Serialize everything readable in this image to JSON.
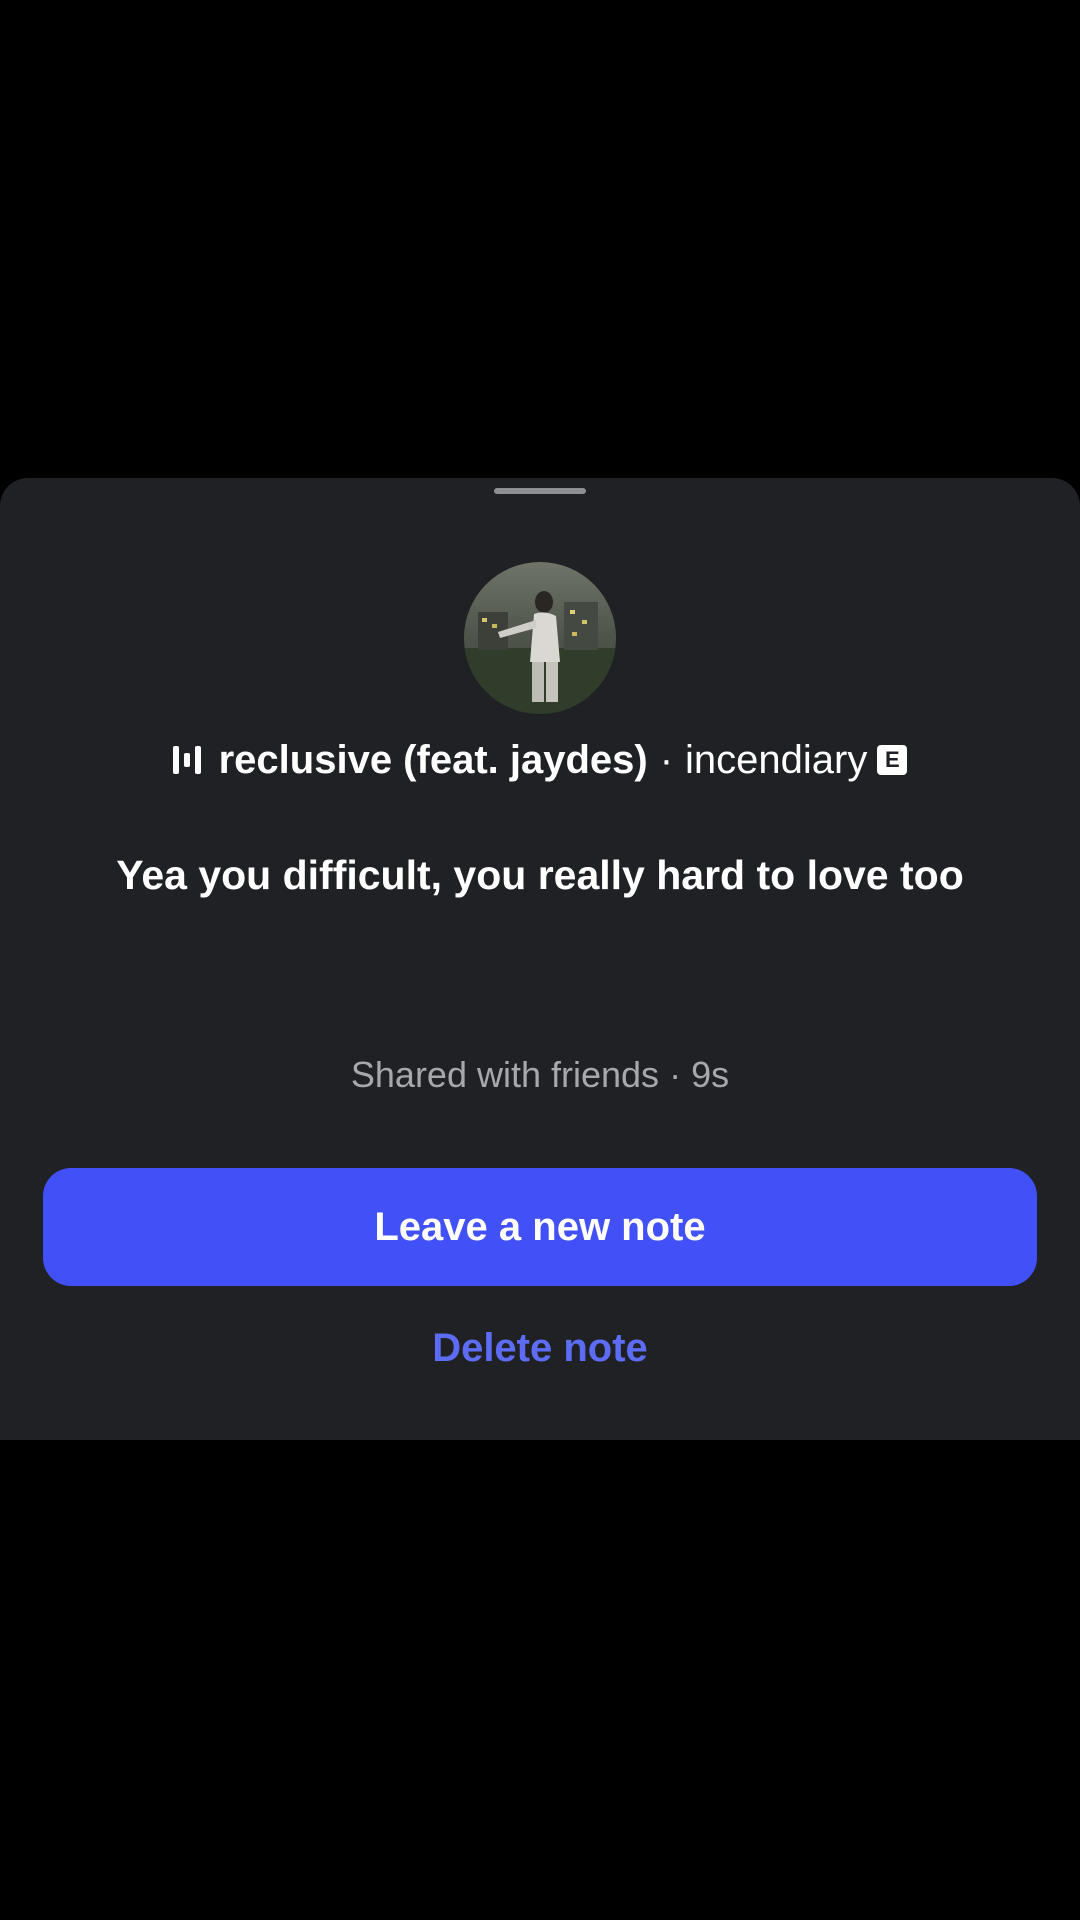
{
  "note_sheet": {
    "music": {
      "icon": "music-equalizer-icon",
      "song_title": "reclusive (feat. jaydes)",
      "separator": "·",
      "artist": "incendiary",
      "explicit_badge": "E"
    },
    "note_text": "Yea you difficult, you really hard to love too",
    "audience": "Shared with friends",
    "meta_separator": "·",
    "time_ago": "9s",
    "primary_action_label": "Leave a new note",
    "secondary_action_label": "Delete note"
  },
  "colors": {
    "sheet_background": "#202125",
    "primary_button": "#4150f7",
    "delete_link": "#5d6cf5",
    "meta_text": "#a7a8ad"
  }
}
